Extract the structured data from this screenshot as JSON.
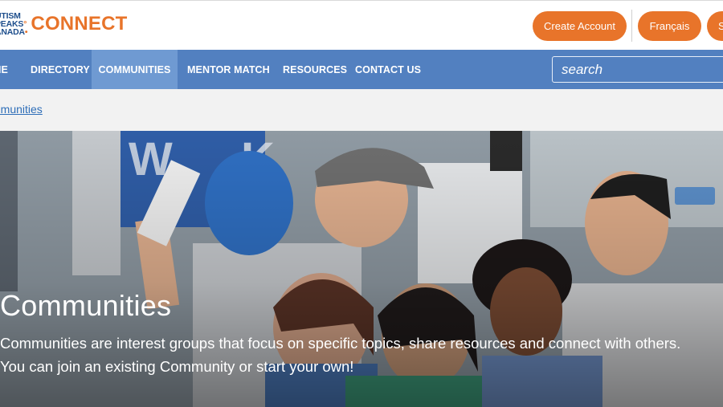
{
  "header": {
    "logo_lines": [
      "UTISM",
      "PEAKS",
      "ANADA"
    ],
    "logo_wordmark": "CONNECT",
    "create_account": "Create Account",
    "language": "Français",
    "partial_button": "S"
  },
  "nav": {
    "items": [
      {
        "label": "ME"
      },
      {
        "label": "DIRECTORY"
      },
      {
        "label": "COMMUNITIES",
        "active": true
      },
      {
        "label": "MENTOR MATCH"
      },
      {
        "label": "RESOURCES"
      },
      {
        "label": "CONTACT US"
      }
    ],
    "search_placeholder": "search"
  },
  "breadcrumb": {
    "label": "mmunities"
  },
  "hero": {
    "image": "people-celebrating-photo",
    "title": "Communities",
    "description_line1": "Communities are interest groups that focus on specific topics, share resources and connect with others.",
    "description_line2": "You can join an existing Community or start your own!"
  },
  "colors": {
    "accent_orange": "#e8742a",
    "nav_blue": "#5280c0",
    "nav_active": "#6f9ad2",
    "link_blue": "#2e6eb8"
  }
}
